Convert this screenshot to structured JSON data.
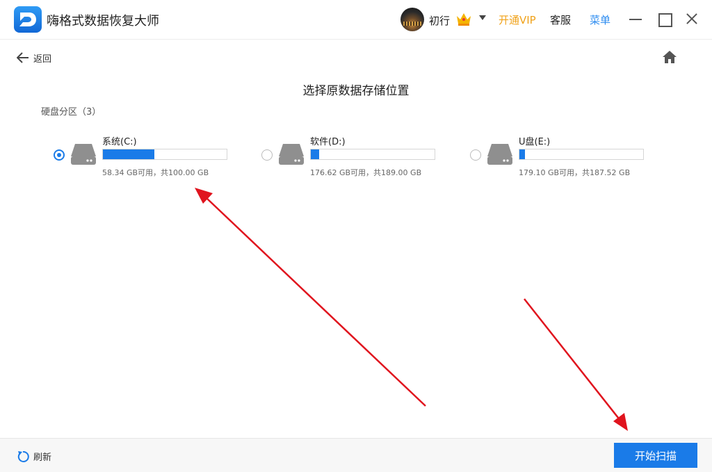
{
  "app": {
    "title": "嗨格式数据恢复大师",
    "logo_icon": "d-logo-icon"
  },
  "header": {
    "username": "初行",
    "vip_label": "开通VIP",
    "service_label": "客服",
    "menu_label": "菜单",
    "vip_color": "#f0a21a",
    "menu_color": "#2d8cf0"
  },
  "nav": {
    "back_label": "返回"
  },
  "main": {
    "heading": "选择原数据存储位置",
    "section_label": "硬盘分区（3）",
    "partitions": [
      {
        "name": "系统(C:)",
        "size_text": "58.34 GB可用，共100.00 GB",
        "used_fraction": 0.4166,
        "selected": true
      },
      {
        "name": "软件(D:)",
        "size_text": "176.62 GB可用，共189.00 GB",
        "used_fraction": 0.0655,
        "selected": false
      },
      {
        "name": "U盘(E:)",
        "size_text": "179.10 GB可用，共187.52 GB",
        "used_fraction": 0.0449,
        "selected": false
      }
    ]
  },
  "footer": {
    "refresh_label": "刷新",
    "start_label": "开始扫描"
  },
  "colors": {
    "accent": "#1a7be8",
    "annotation_arrow": "#e0141e"
  }
}
